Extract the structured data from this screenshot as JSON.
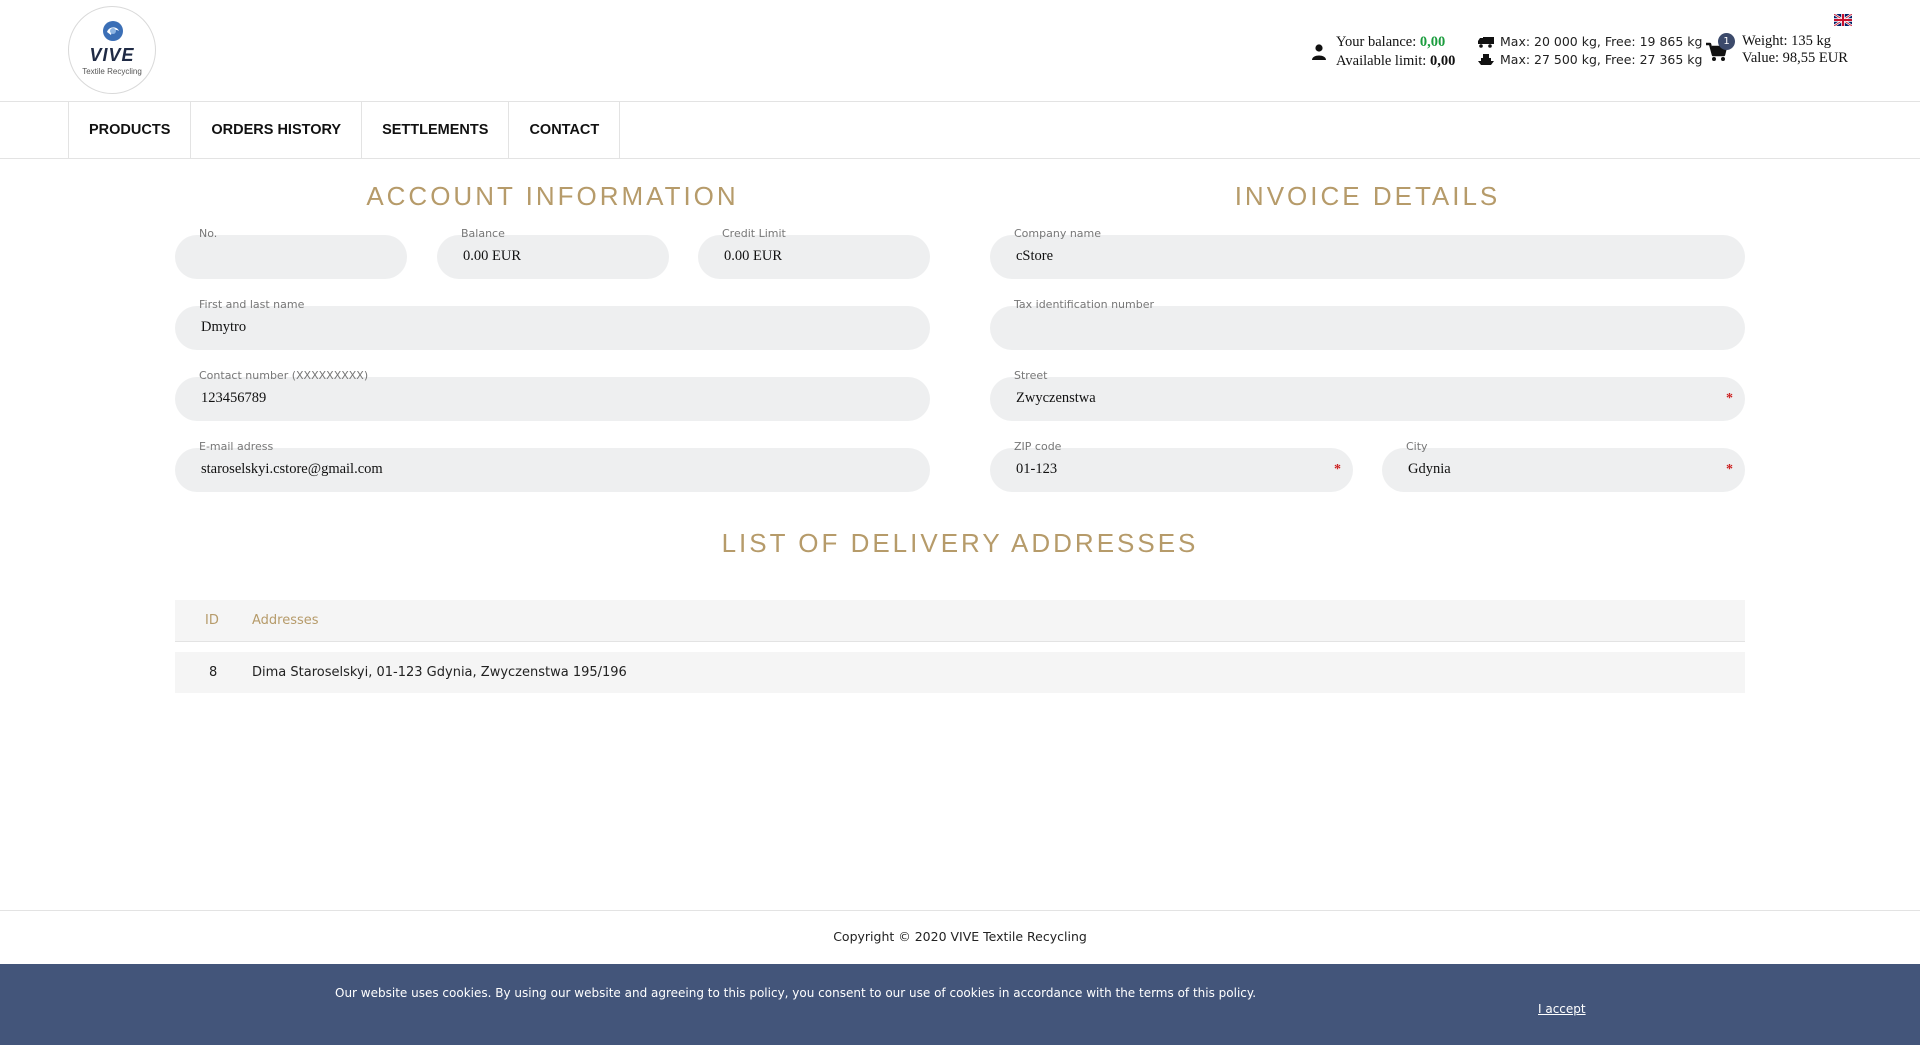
{
  "brand": {
    "logo_text": "VIVE",
    "logo_sub": "Textile Recycling"
  },
  "header": {
    "balance_label": "Your balance:",
    "balance_value": "0,00",
    "limit_label": "Available limit:",
    "limit_value": "0,00",
    "truck_capacity": "Max: 20 000 kg, Free: 19 865 kg",
    "ship_capacity": "Max: 27 500 kg, Free: 27 365 kg",
    "cart_count": "1",
    "weight": "Weight: 135 kg",
    "value": "Value: 98,55 EUR",
    "language": "en-flag-icon"
  },
  "nav": {
    "items": [
      "PRODUCTS",
      "ORDERS HISTORY",
      "SETTLEMENTS",
      "CONTACT"
    ]
  },
  "account": {
    "title": "ACCOUNT INFORMATION",
    "no_label": "No.",
    "no_value": "",
    "balance_label": "Balance",
    "balance_value": "0.00 EUR",
    "credit_label": "Credit Limit",
    "credit_value": "0.00 EUR",
    "name_label": "First and last name",
    "name_value": "Dmytro",
    "phone_label": "Contact number (XXXXXXXXX)",
    "phone_value": "123456789",
    "email_label": "E-mail adress",
    "email_value": "staroselskyi.cstore@gmail.com"
  },
  "invoice": {
    "title": "INVOICE DETAILS",
    "company_label": "Company name",
    "company_value": "cStore",
    "tax_label": "Tax identification number",
    "tax_value": "",
    "street_label": "Street",
    "street_value": "Zwyczenstwa",
    "zip_label": "ZIP code",
    "zip_value": "01-123",
    "city_label": "City",
    "city_value": "Gdynia",
    "required_mark": "*"
  },
  "delivery": {
    "title": "LIST OF DELIVERY ADDRESSES",
    "columns": [
      "ID",
      "Addresses"
    ],
    "rows": [
      {
        "id": "8",
        "address": "Dima Staroselskyi, 01-123 Gdynia, Zwyczenstwa 195/196"
      }
    ]
  },
  "footer": {
    "copyright": "Copyright © 2020 VIVE Textile Recycling"
  },
  "cookie": {
    "text": "Our website uses cookies. By using our website and agreeing to this policy, you consent to our use of cookies in accordance with the terms of this policy.",
    "accept": "I accept"
  },
  "colors": {
    "accent_gold": "#b69b6a",
    "cookie_bar": "#43557a",
    "balance_green": "#1a9c3d",
    "required_red": "#cc1f1f"
  }
}
